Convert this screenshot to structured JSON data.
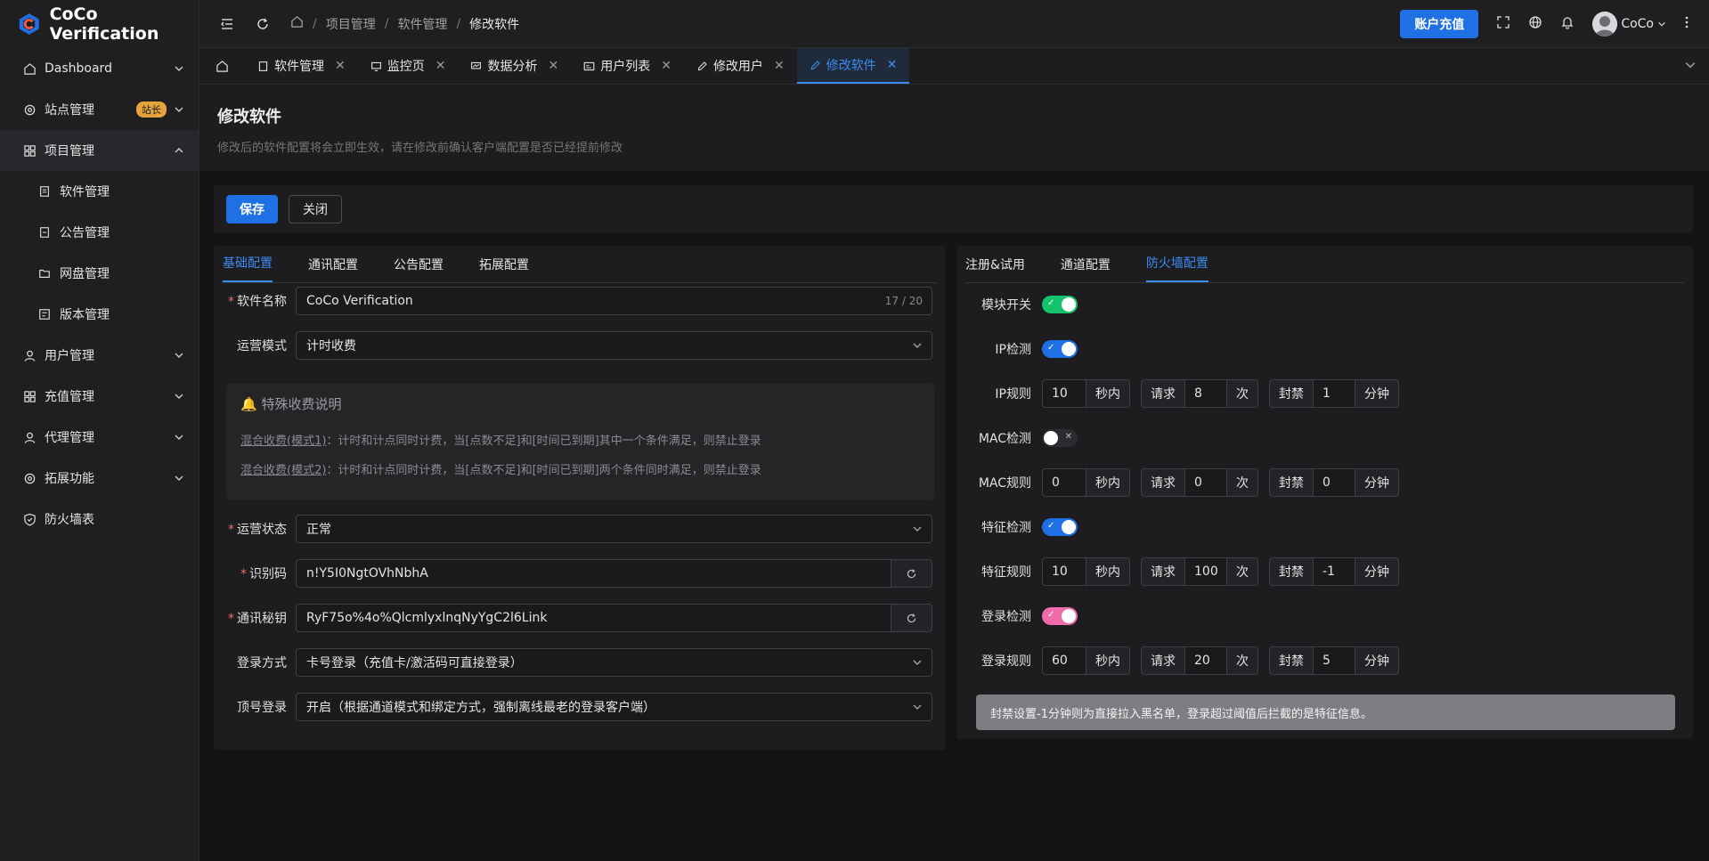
{
  "app": {
    "name": "CoCo Verification"
  },
  "sidebar": {
    "items": [
      {
        "label": "Dashboard"
      },
      {
        "label": "站点管理",
        "badge": "站长"
      },
      {
        "label": "项目管理"
      },
      {
        "label": "用户管理"
      },
      {
        "label": "充值管理"
      },
      {
        "label": "代理管理"
      },
      {
        "label": "拓展功能"
      },
      {
        "label": "防火墙表"
      }
    ],
    "subitems": [
      {
        "label": "软件管理"
      },
      {
        "label": "公告管理"
      },
      {
        "label": "网盘管理"
      },
      {
        "label": "版本管理"
      }
    ]
  },
  "header": {
    "breadcrumb": [
      "项目管理",
      "软件管理",
      "修改软件"
    ],
    "recharge": "账户充值",
    "user": "CoCo"
  },
  "tabs": [
    "软件管理",
    "监控页",
    "数据分析",
    "用户列表",
    "修改用户",
    "修改软件"
  ],
  "page": {
    "title": "修改软件",
    "desc": "修改后的软件配置将会立即生效，请在修改前确认客户端配置是否已经提前修改",
    "save": "保存",
    "close": "关闭"
  },
  "left": {
    "tabs": [
      "基础配置",
      "通讯配置",
      "公告配置",
      "拓展配置"
    ],
    "fields": {
      "name_label": "软件名称",
      "name_value": "CoCo Verification",
      "name_count": "17 / 20",
      "mode_label": "运营模式",
      "mode_value": "计时收费",
      "status_label": "运营状态",
      "status_value": "正常",
      "code_label": "识别码",
      "code_value": "n!Y5I0NgtOVhNbhA",
      "secret_label": "通讯秘钥",
      "secret_value": "RyF75o%4o%QlcmlyxlnqNyYgC2l6Link",
      "login_label": "登录方式",
      "login_value": "卡号登录（充值卡/激活码可直接登录）",
      "top_label": "顶号登录",
      "top_value": "开启（根据通道模式和绑定方式，强制离线最老的登录客户端）"
    },
    "notice": {
      "title": "特殊收费说明",
      "line1_link": "混合收费(模式1)",
      "line1_text": "：计时和计点同时计费，当[点数不足]和[时间已到期]其中一个条件满足，则禁止登录",
      "line2_link": "混合收费(模式2)",
      "line2_text": "：计时和计点同时计费，当[点数不足]和[时间已到期]两个条件同时满足，则禁止登录"
    }
  },
  "right": {
    "tabs": [
      "注册&试用",
      "通道配置",
      "防火墙配置"
    ],
    "labels": {
      "module": "模块开关",
      "ip_check": "IP检测",
      "ip_rule": "IP规则",
      "mac_check": "MAC检测",
      "mac_rule": "MAC规则",
      "feat_check": "特征检测",
      "feat_rule": "特征规则",
      "login_check": "登录检测",
      "login_rule": "登录规则"
    },
    "units": {
      "sec": "秒内",
      "req": "请求",
      "times": "次",
      "ban": "封禁",
      "min": "分钟"
    },
    "rules": {
      "ip": [
        "10",
        "8",
        "1"
      ],
      "mac": [
        "0",
        "0",
        "0"
      ],
      "feat": [
        "10",
        "100",
        "-1"
      ],
      "login": [
        "60",
        "20",
        "5"
      ]
    },
    "switch_colors": {
      "module": "#13c26b",
      "ip": "#1f6fe5",
      "mac": "#2c2c30",
      "feat": "#1f6fe5",
      "login": "#f06ba8"
    },
    "alert": "封禁设置-1分钟则为直接拉入黑名单，登录超过阈值后拦截的是特征信息。"
  }
}
